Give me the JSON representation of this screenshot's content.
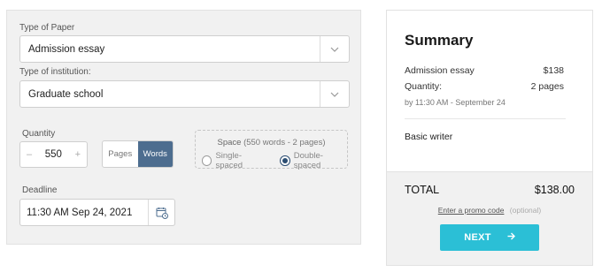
{
  "form": {
    "paper_label": "Type of Paper",
    "paper_value": "Admission essay",
    "institution_label": "Type of institution:",
    "institution_value": "Graduate school",
    "quantity_label": "Quantity",
    "quantity_minus": "–",
    "quantity_value": "550",
    "quantity_plus": "+",
    "unit_options": [
      "Pages",
      "Words"
    ],
    "unit_selected": "Words",
    "space_title": "Space",
    "space_hint": "(550 words - 2 pages)",
    "space_options": [
      "Single-spaced",
      "Double-spaced"
    ],
    "space_selected": "Double-spaced",
    "deadline_label": "Deadline",
    "deadline_value": "11:30 AM Sep 24, 2021"
  },
  "summary": {
    "title": "Summary",
    "item_name": "Admission essay",
    "item_price": "$138",
    "quantity_label": "Quantity:",
    "quantity_value": "2 pages",
    "deadline_text": "by 11:30 AM - September 24",
    "writer": "Basic writer",
    "total_label": "TOTAL",
    "total_value": "$138.00",
    "promo_link": "Enter a promo code",
    "promo_optional": "(optional)",
    "next_label": "NEXT"
  },
  "colors": {
    "accent_button": "#2bbfd6",
    "selected_segment": "#4d6d8f",
    "radio_checked": "#2b4d72"
  },
  "icons": [
    "chevron-down-icon",
    "calendar-icon",
    "arrow-right-icon"
  ]
}
